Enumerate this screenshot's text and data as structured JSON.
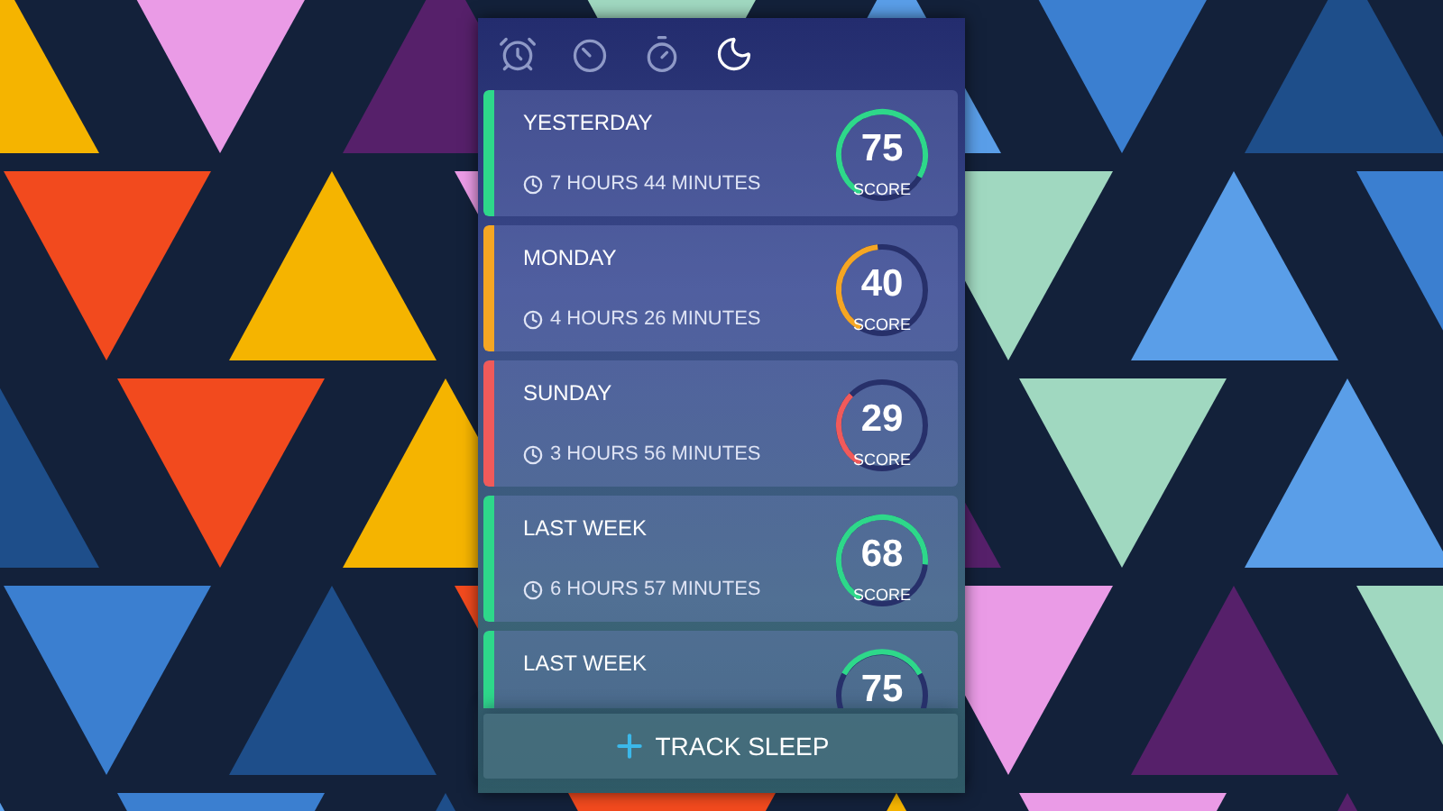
{
  "tabs": [
    {
      "kind": "alarm",
      "selected": false
    },
    {
      "kind": "timer",
      "selected": false
    },
    {
      "kind": "stopwatch",
      "selected": false
    },
    {
      "kind": "sleep",
      "selected": true
    }
  ],
  "entries": [
    {
      "title": "YESTERDAY",
      "duration": "7 HOURS 44 MINUTES",
      "score": "75",
      "score_label": "SCORE",
      "level": 0.75,
      "color": "#2ed88a"
    },
    {
      "title": "MONDAY",
      "duration": "4 HOURS 26 MINUTES",
      "score": "40",
      "score_label": "SCORE",
      "level": 0.4,
      "color": "#f5a623"
    },
    {
      "title": "SUNDAY",
      "duration": "3 HOURS 56 MINUTES",
      "score": "29",
      "score_label": "SCORE",
      "level": 0.29,
      "color": "#f05a5a"
    },
    {
      "title": "LAST WEEK",
      "duration": "6 HOURS 57 MINUTES",
      "score": "68",
      "score_label": "SCORE",
      "level": 0.68,
      "color": "#2ed88a"
    },
    {
      "title": "LAST WEEK",
      "score": "75",
      "color": "#2ed88a"
    }
  ],
  "action": {
    "label": "TRACK SLEEP"
  }
}
